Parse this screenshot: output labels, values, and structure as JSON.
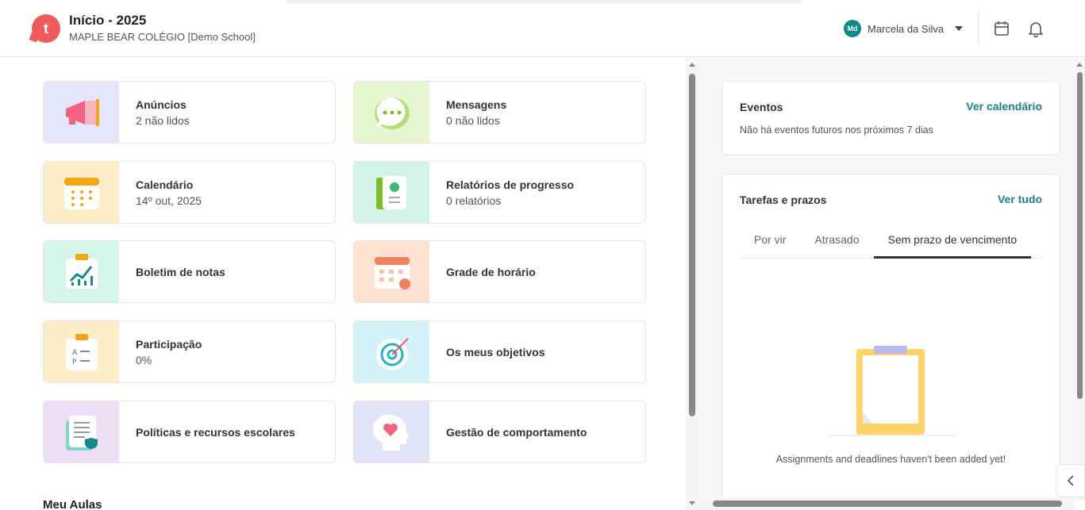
{
  "header": {
    "logo_letter": "t",
    "title": "Início - 2025",
    "subtitle": "MAPLE BEAR COLÉGIO [Demo School]",
    "user_initials": "Md",
    "user_name": "Marcela da Silva"
  },
  "cards": [
    {
      "title": "Anúncios",
      "subtitle": "2 não lidos",
      "icon": "megaphone-icon",
      "bg": "#e6e6fb"
    },
    {
      "title": "Mensagens",
      "subtitle": "0 não lidos",
      "icon": "chat-bubble-icon",
      "bg": "#e6f4d0"
    },
    {
      "title": "Calendário",
      "subtitle": "14º out, 2025",
      "icon": "calendar-icon",
      "bg": "#fdeec7"
    },
    {
      "title": "Relatórios de progresso",
      "subtitle": "0 relatórios",
      "icon": "report-card-icon",
      "bg": "#d3f3e6"
    },
    {
      "title": "Boletim de notas",
      "subtitle": "",
      "icon": "grade-chart-icon",
      "bg": "#d5f4ec"
    },
    {
      "title": "Grade de horário",
      "subtitle": "",
      "icon": "timetable-icon",
      "bg": "#fde1d3"
    },
    {
      "title": "Participação",
      "subtitle": "0%",
      "icon": "attendance-clipboard-icon",
      "bg": "#fdeec7"
    },
    {
      "title": "Os meus objetivos",
      "subtitle": "",
      "icon": "target-icon",
      "bg": "#d3f1f8"
    },
    {
      "title": "Políticas e recursos escolares",
      "subtitle": "",
      "icon": "policy-document-icon",
      "bg": "#ecdff5"
    },
    {
      "title": "Gestão de comportamento",
      "subtitle": "",
      "icon": "behavior-heart-icon",
      "bg": "#e3e3f8"
    }
  ],
  "main": {
    "section_title": "Meu Aulas"
  },
  "events": {
    "title": "Eventos",
    "link": "Ver calendário",
    "empty": "Não há eventos futuros nos próximos 7 dias"
  },
  "tasks": {
    "title": "Tarefas e prazos",
    "link": "Ver tudo",
    "tabs": [
      "Por vir",
      "Atrasado",
      "Sem prazo de vencimento"
    ],
    "active_tab": "Sem prazo de vencimento",
    "empty": "Assignments and deadlines haven't been added yet!"
  }
}
